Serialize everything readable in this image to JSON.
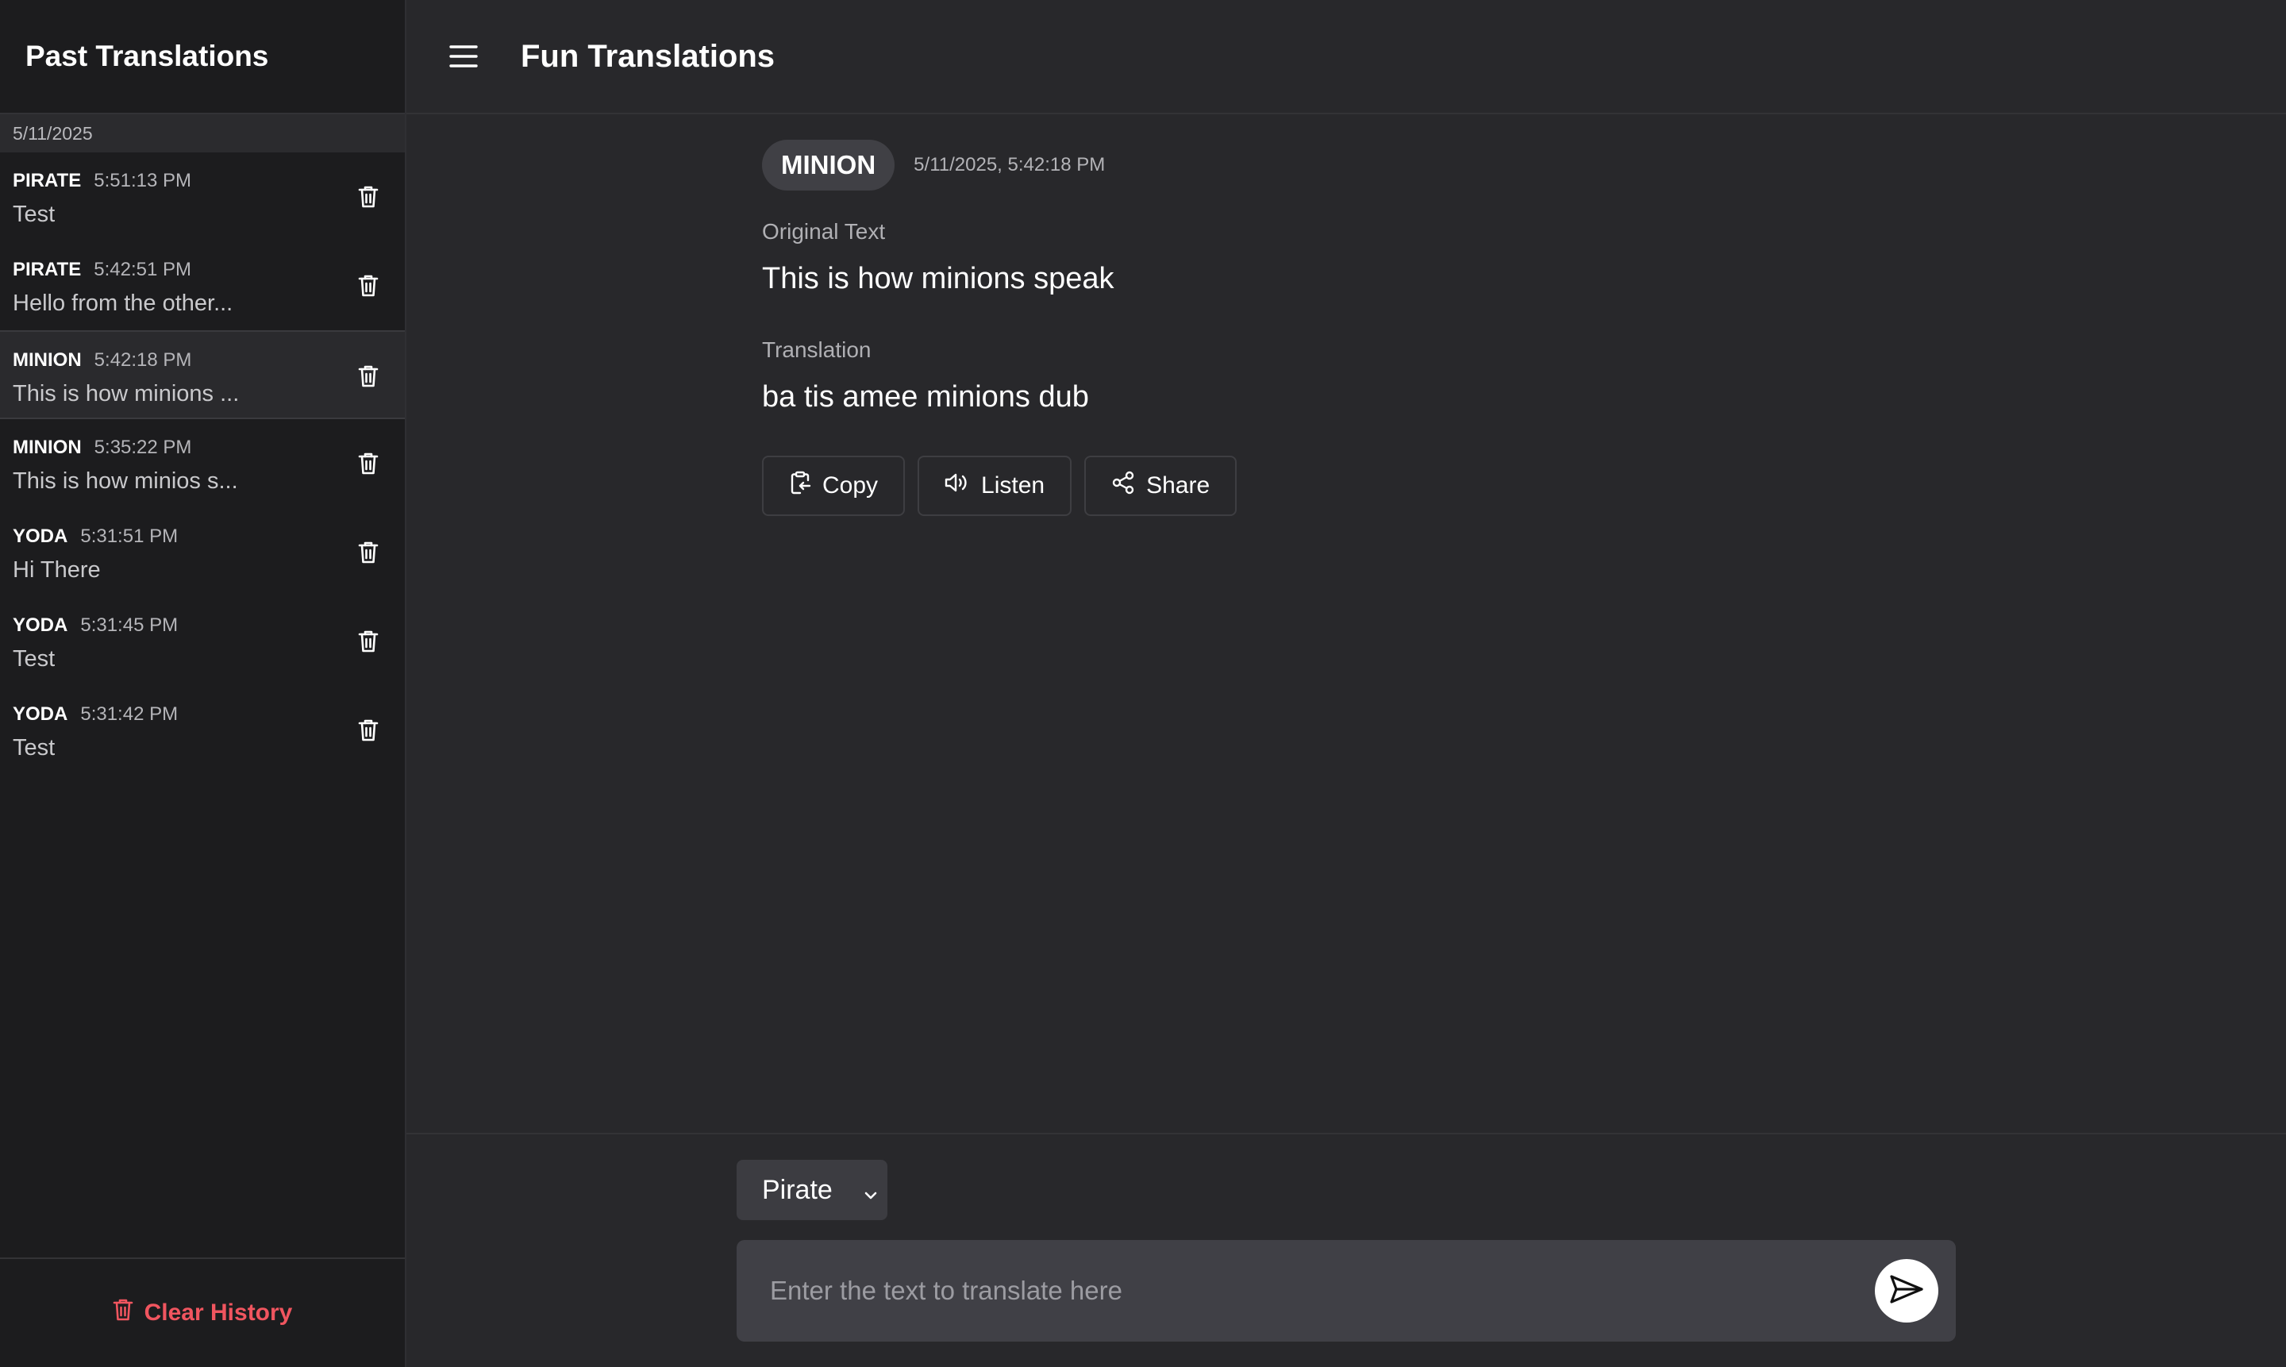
{
  "sidebar": {
    "title": "Past Translations",
    "date_group": "5/11/2025",
    "items": [
      {
        "style": "PIRATE",
        "time": "5:51:13 PM",
        "text": "Test"
      },
      {
        "style": "PIRATE",
        "time": "5:42:51 PM",
        "text": "Hello from the other..."
      },
      {
        "style": "MINION",
        "time": "5:42:18 PM",
        "text": "This is how minions ..."
      },
      {
        "style": "MINION",
        "time": "5:35:22 PM",
        "text": "This is how minios s..."
      },
      {
        "style": "YODA",
        "time": "5:31:51 PM",
        "text": "Hi There"
      },
      {
        "style": "YODA",
        "time": "5:31:45 PM",
        "text": "Test"
      },
      {
        "style": "YODA",
        "time": "5:31:42 PM",
        "text": "Test"
      }
    ],
    "active_index": 2,
    "clear_label": "Clear History"
  },
  "header": {
    "title": "Fun Translations",
    "menu_icon": "hamburger-menu-icon"
  },
  "main": {
    "style_badge": "MINION",
    "timestamp": "5/11/2025, 5:42:18 PM",
    "original_label": "Original Text",
    "original_text": "This is how minions speak",
    "translation_label": "Translation",
    "translation_text": "ba tis amee minions dub",
    "actions": {
      "copy": "Copy",
      "listen": "Listen",
      "share": "Share"
    }
  },
  "composer": {
    "selected_style": "Pirate",
    "placeholder": "Enter the text to translate here"
  },
  "colors": {
    "background": "#28282b",
    "sidebar": "#1c1c1e",
    "danger": "#f0555f",
    "badge": "#404045",
    "input": "#404046"
  }
}
